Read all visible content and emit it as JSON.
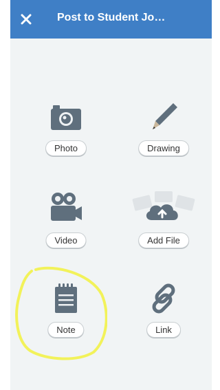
{
  "header": {
    "title": "Post to Student Jo…",
    "close_icon": "close-icon"
  },
  "options": [
    {
      "label": "Photo",
      "icon": "camera-icon"
    },
    {
      "label": "Drawing",
      "icon": "pencil-icon"
    },
    {
      "label": "Video",
      "icon": "video-camera-icon"
    },
    {
      "label": "Add File",
      "icon": "cloud-upload-icon"
    },
    {
      "label": "Note",
      "icon": "notepad-icon"
    },
    {
      "label": "Link",
      "icon": "link-icon"
    }
  ],
  "colors": {
    "header": "#3f7fc6",
    "icon": "#5f6f7d",
    "background": "#f1f4f5",
    "highlight": "#f2f25a"
  }
}
